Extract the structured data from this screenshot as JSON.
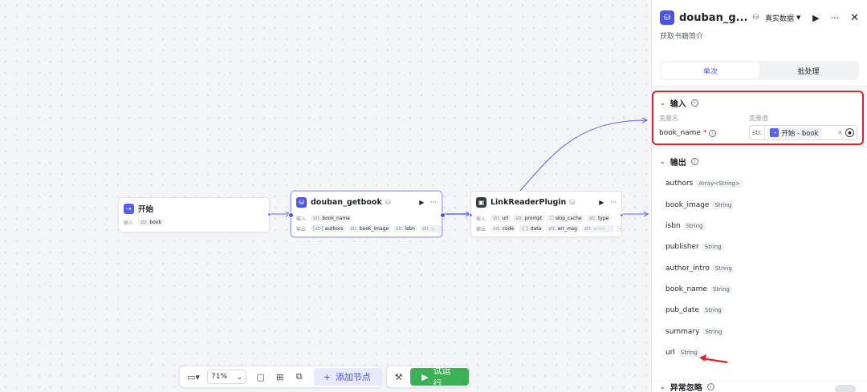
{
  "nodes": {
    "start": {
      "title": "开始",
      "input_label": "输入",
      "params": [
        {
          "type": "str.",
          "name": "book"
        }
      ]
    },
    "douban": {
      "title": "douban_getbook",
      "tag": "⛁",
      "input_label": "输入",
      "output_label": "输出",
      "inputs": [
        {
          "type": "str.",
          "name": "book_name"
        }
      ],
      "outputs": [
        {
          "type": "[str]",
          "name": "authors"
        },
        {
          "type": "str.",
          "name": "book_image"
        },
        {
          "type": "str.",
          "name": "isbn"
        },
        {
          "type": "str.",
          "name": "p..."
        }
      ],
      "more": "···"
    },
    "linkreader": {
      "title": "LinkReaderPlugin",
      "tag": "⛁",
      "input_label": "输入",
      "output_label": "输出",
      "inputs": [
        {
          "type": "str.",
          "name": "url"
        },
        {
          "type": "str.",
          "name": "prompt"
        },
        {
          "type": "☐",
          "name": "skip_cache"
        },
        {
          "type": "str.",
          "name": "type"
        }
      ],
      "outputs": [
        {
          "type": "int.",
          "name": "code"
        },
        {
          "type": "{ }",
          "name": "data"
        },
        {
          "type": "str.",
          "name": "err_msg"
        },
        {
          "type": "str.",
          "name": "error_..."
        }
      ],
      "more": "···"
    }
  },
  "toolbar": {
    "zoom": "71%",
    "add_node": "添加节点",
    "run": "试运行"
  },
  "panel": {
    "title": "douban_g...",
    "tag_icon": "plugin-db-icon",
    "data_mode": "真实数据",
    "description": "获取书籍简介",
    "tabs": [
      {
        "label": "单次",
        "active": true
      },
      {
        "label": "批处理",
        "active": false
      }
    ],
    "input_section": {
      "title": "输入",
      "col_name": "变量名",
      "col_value": "变量值",
      "var_name": "book_name",
      "required_mark": "*",
      "value_type": "str.",
      "value_ref": "开始 - book"
    },
    "output_section": {
      "title": "输出",
      "items": [
        {
          "name": "authors",
          "type": "Array<String>"
        },
        {
          "name": "book_image",
          "type": "String"
        },
        {
          "name": "isbn",
          "type": "String"
        },
        {
          "name": "publisher",
          "type": "String"
        },
        {
          "name": "author_intro",
          "type": "String"
        },
        {
          "name": "book_name",
          "type": "String"
        },
        {
          "name": "pub_date",
          "type": "String"
        },
        {
          "name": "summary",
          "type": "String"
        },
        {
          "name": "url",
          "type": "String"
        }
      ]
    },
    "exception_section": {
      "title": "异常忽略"
    }
  },
  "colors": {
    "accent": "#4d53e8",
    "run_green": "#3cb054",
    "highlight_red": "#e0202a"
  }
}
